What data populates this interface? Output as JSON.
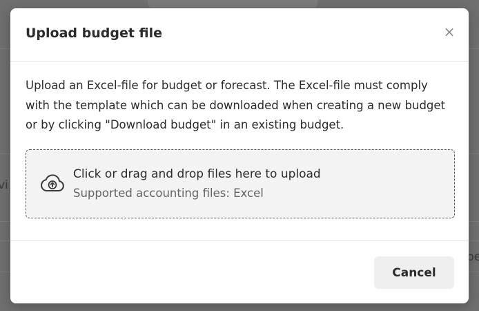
{
  "background": {
    "left_fragment": "vi",
    "right_fragment": "be"
  },
  "modal": {
    "title": "Upload budget file",
    "close_glyph": "×",
    "description": "Upload an Excel-file for budget or forecast. The Excel-file must comply with the template which can be downloaded when creating a new budget or by clicking \"Download budget\" in an existing budget.",
    "dropzone": {
      "icon": "cloud-upload-icon",
      "title": "Click or drag and drop files here to upload",
      "subtitle": "Supported accounting files: Excel"
    },
    "footer": {
      "cancel_label": "Cancel"
    }
  },
  "colors": {
    "overlay": "#6f6f6f",
    "dropzone_bg": "#f3f3f3",
    "cancel_bg": "#efefef",
    "text": "#2b2b2b",
    "muted_text": "#646464"
  }
}
